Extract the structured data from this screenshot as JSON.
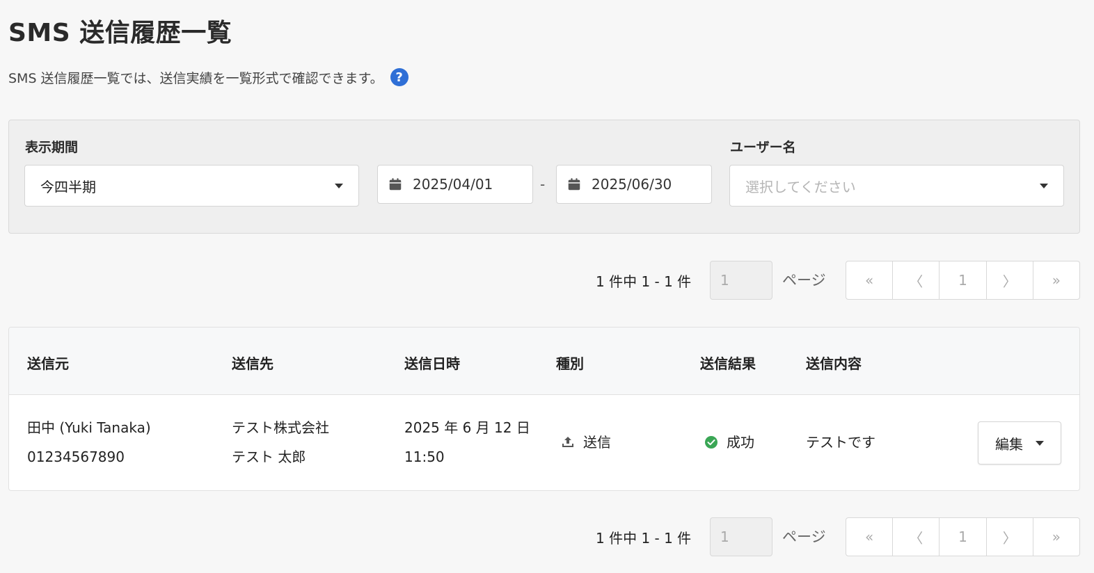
{
  "page": {
    "title": "SMS 送信履歴一覧",
    "description": "SMS 送信履歴一覧では、送信実績を一覧形式で確認できます。",
    "help_icon": "help-icon"
  },
  "filters": {
    "period_label": "表示期間",
    "period_value": "今四半期",
    "start_date": "2025/04/01",
    "separator": "-",
    "end_date": "2025/06/30",
    "user_label": "ユーザー名",
    "user_placeholder": "選択してください"
  },
  "pagination": {
    "summary": "1 件中 1 - 1 件",
    "page_input": "1",
    "page_label": "ページ",
    "first": "«",
    "prev": "〈",
    "current": "1",
    "next": "〉",
    "last": "»"
  },
  "table": {
    "headers": [
      "送信元",
      "送信先",
      "送信日時",
      "種別",
      "送信結果",
      "送信内容"
    ],
    "rows": [
      {
        "sender_name": "田中 (Yuki Tanaka)",
        "sender_number": "01234567890",
        "recipient_company": "テスト株式会社",
        "recipient_name": "テスト 太郎",
        "sent_date": "2025 年 6 月 12 日",
        "sent_time": "11:50",
        "type": "送信",
        "type_icon": "upload-icon",
        "result": "成功",
        "result_icon": "check-circle-icon",
        "content": "テストです",
        "action": "編集"
      }
    ]
  },
  "colors": {
    "help": "#2f6fd6",
    "success": "#3aa655"
  }
}
